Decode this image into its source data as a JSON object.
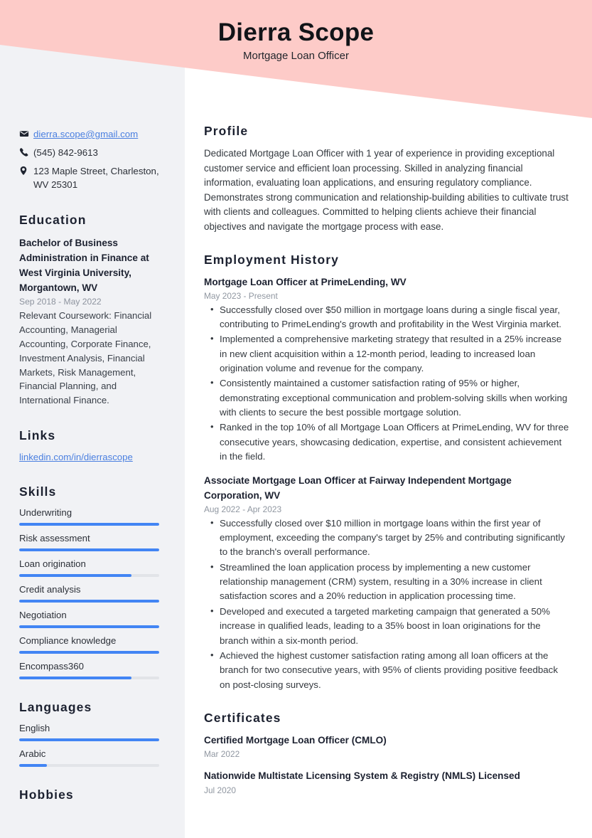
{
  "colors": {
    "header_pink": "#fdcbc8",
    "sidebar_bg": "#f1f2f5",
    "accent_blue": "#4285f4",
    "link_blue": "#4a7fe0",
    "heading_dark": "#1c2130",
    "muted_gray": "#9097a1"
  },
  "header": {
    "name": "Dierra Scope",
    "job_title": "Mortgage Loan Officer"
  },
  "sidebar": {
    "contact": [
      {
        "icon": "envelope-icon",
        "text": "dierra.scope@gmail.com",
        "is_link": true
      },
      {
        "icon": "phone-icon",
        "text": "(545) 842-9613",
        "is_link": false
      },
      {
        "icon": "location-pin-icon",
        "text": "123 Maple Street, Charleston, WV 25301",
        "is_link": false
      }
    ],
    "education": {
      "heading": "Education",
      "entries": [
        {
          "title": "Bachelor of Business Administration in Finance at West Virginia University, Morgantown, WV",
          "date": "Sep 2018 - May 2022",
          "description": "Relevant Coursework: Financial Accounting, Managerial Accounting, Corporate Finance, Investment Analysis, Financial Markets, Risk Management, Financial Planning, and International Finance."
        }
      ]
    },
    "links": {
      "heading": "Links",
      "items": [
        {
          "label": "linkedin.com/in/dierrascope"
        }
      ]
    },
    "skills": {
      "heading": "Skills",
      "items": [
        {
          "label": "Underwriting",
          "level": 100
        },
        {
          "label": "Risk assessment",
          "level": 100
        },
        {
          "label": "Loan origination",
          "level": 80
        },
        {
          "label": "Credit analysis",
          "level": 100
        },
        {
          "label": "Negotiation",
          "level": 100
        },
        {
          "label": "Compliance knowledge",
          "level": 100
        },
        {
          "label": "Encompass360",
          "level": 80
        }
      ]
    },
    "languages": {
      "heading": "Languages",
      "items": [
        {
          "label": "English",
          "level": 100
        },
        {
          "label": "Arabic",
          "level": 20
        }
      ]
    },
    "hobbies": {
      "heading": "Hobbies"
    }
  },
  "main": {
    "profile": {
      "heading": "Profile",
      "text": "Dedicated Mortgage Loan Officer with 1 year of experience in providing exceptional customer service and efficient loan processing. Skilled in analyzing financial information, evaluating loan applications, and ensuring regulatory compliance. Demonstrates strong communication and relationship-building abilities to cultivate trust with clients and colleagues. Committed to helping clients achieve their financial objectives and navigate the mortgage process with ease."
    },
    "employment": {
      "heading": "Employment History",
      "jobs": [
        {
          "title": "Mortgage Loan Officer at PrimeLending, WV",
          "date": "May 2023 - Present",
          "bullets": [
            "Successfully closed over $50 million in mortgage loans during a single fiscal year, contributing to PrimeLending's growth and profitability in the West Virginia market.",
            "Implemented a comprehensive marketing strategy that resulted in a 25% increase in new client acquisition within a 12-month period, leading to increased loan origination volume and revenue for the company.",
            "Consistently maintained a customer satisfaction rating of 95% or higher, demonstrating exceptional communication and problem-solving skills when working with clients to secure the best possible mortgage solution.",
            "Ranked in the top 10% of all Mortgage Loan Officers at PrimeLending, WV for three consecutive years, showcasing dedication, expertise, and consistent achievement in the field."
          ]
        },
        {
          "title": "Associate Mortgage Loan Officer at Fairway Independent Mortgage Corporation, WV",
          "date": "Aug 2022 - Apr 2023",
          "bullets": [
            "Successfully closed over $10 million in mortgage loans within the first year of employment, exceeding the company's target by 25% and contributing significantly to the branch's overall performance.",
            "Streamlined the loan application process by implementing a new customer relationship management (CRM) system, resulting in a 30% increase in client satisfaction scores and a 20% reduction in application processing time.",
            "Developed and executed a targeted marketing campaign that generated a 50% increase in qualified leads, leading to a 35% boost in loan originations for the branch within a six-month period.",
            "Achieved the highest customer satisfaction rating among all loan officers at the branch for two consecutive years, with 95% of clients providing positive feedback on post-closing surveys."
          ]
        }
      ]
    },
    "certificates": {
      "heading": "Certificates",
      "items": [
        {
          "title": "Certified Mortgage Loan Officer (CMLO)",
          "date": "Mar 2022"
        },
        {
          "title": "Nationwide Multistate Licensing System & Registry (NMLS) Licensed",
          "date": "Jul 2020"
        }
      ]
    }
  }
}
